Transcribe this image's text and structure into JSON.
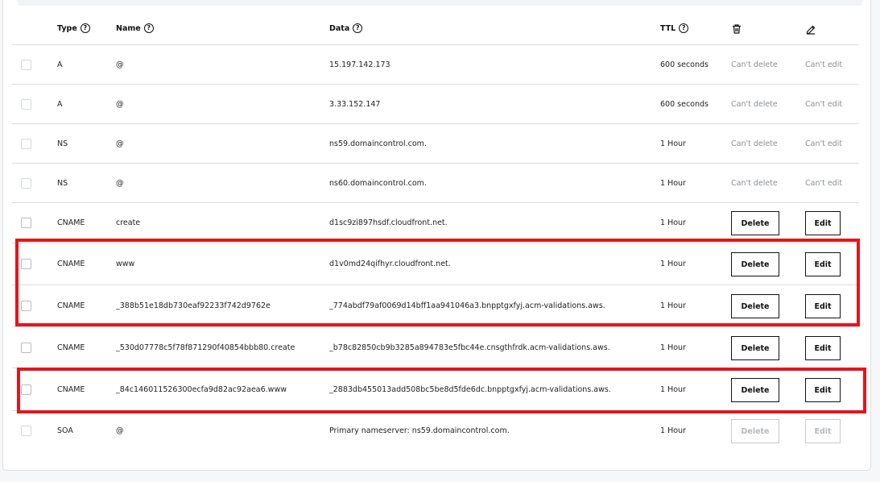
{
  "header": {
    "type": "Type",
    "name": "Name",
    "data": "Data",
    "ttl": "TTL",
    "help_glyph": "?",
    "delete_icon": "trash-icon",
    "edit_icon": "pencil-icon"
  },
  "records": [
    {
      "type": "A",
      "name": "@",
      "data": "15.197.142.173",
      "ttl": "600 seconds",
      "delete": "Can't delete",
      "edit": "Can't edit",
      "mode": "locked"
    },
    {
      "type": "A",
      "name": "@",
      "data": "3.33.152.147",
      "ttl": "600 seconds",
      "delete": "Can't delete",
      "edit": "Can't edit",
      "mode": "locked"
    },
    {
      "type": "NS",
      "name": "@",
      "data": "ns59.domaincontrol.com.",
      "ttl": "1 Hour",
      "delete": "Can't delete",
      "edit": "Can't edit",
      "mode": "locked"
    },
    {
      "type": "NS",
      "name": "@",
      "data": "ns60.domaincontrol.com.",
      "ttl": "1 Hour",
      "delete": "Can't delete",
      "edit": "Can't edit",
      "mode": "locked"
    },
    {
      "type": "CNAME",
      "name": "create",
      "data": "d1sc9zi897hsdf.cloudfront.net.",
      "ttl": "1 Hour",
      "delete": "Delete",
      "edit": "Edit",
      "mode": "active"
    },
    {
      "type": "CNAME",
      "name": "www",
      "data": "d1v0md24qifhyr.cloudfront.net.",
      "ttl": "1 Hour",
      "delete": "Delete",
      "edit": "Edit",
      "mode": "active"
    },
    {
      "type": "CNAME",
      "name": "_388b51e18db730eaf92233f742d9762e",
      "data": "_774abdf79af0069d14bff1aa941046a3.bnpptgxfyj.acm-validations.aws.",
      "ttl": "1 Hour",
      "delete": "Delete",
      "edit": "Edit",
      "mode": "active"
    },
    {
      "type": "CNAME",
      "name": "_530d07778c5f78f871290f40854bbb80.create",
      "data": "_b78c82850cb9b3285a894783e5fbc44e.cnsgthfrdk.acm-validations.aws.",
      "ttl": "1 Hour",
      "delete": "Delete",
      "edit": "Edit",
      "mode": "active"
    },
    {
      "type": "CNAME",
      "name": "_84c146011526300ecfa9d82ac92aea6.www",
      "data": "_2883db455013add508bc5be8d5fde6dc.bnpptgxfyj.acm-validations.aws.",
      "ttl": "1 Hour",
      "delete": "Delete",
      "edit": "Edit",
      "mode": "active"
    },
    {
      "type": "SOA",
      "name": "@",
      "data": "Primary nameserver: ns59.domaincontrol.com.",
      "ttl": "1 Hour",
      "delete": "Delete",
      "edit": "Edit",
      "mode": "disabled"
    }
  ],
  "colors": {
    "highlight": "#e3161e",
    "muted": "#8a8f94",
    "disabled": "#b5b9bd"
  }
}
